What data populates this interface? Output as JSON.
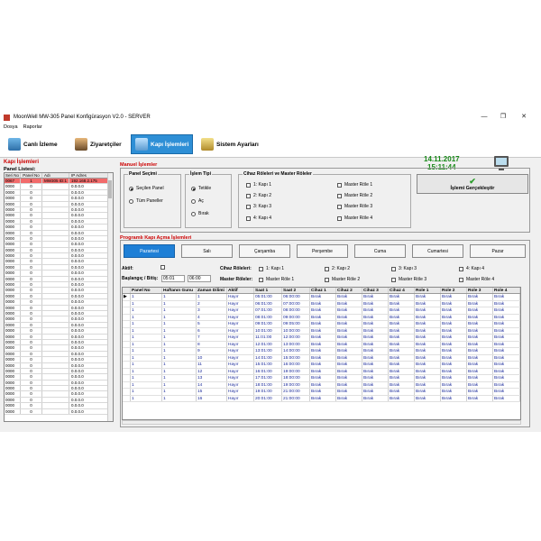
{
  "window": {
    "title": "MoonWell MW-305 Panel Konfigürasyon V2.0 - SERVER",
    "minimize": "—",
    "maximize": "❐",
    "close": "✕"
  },
  "menu": [
    "Dosya",
    "Raporlar"
  ],
  "toolbar": {
    "live": "Canlı İzleme",
    "visitors": "Ziyaretçiler",
    "doors": "Kapı İşlemleri",
    "settings": "Sistem Ayarları"
  },
  "clock": {
    "date": "14.11.2017",
    "time": "15:11:44"
  },
  "section_title": "Kapı İşlemleri",
  "panel_list": {
    "label": "Panel Listesi:",
    "headers": [
      "Seri No",
      "Panel No",
      "Adı",
      "IP Adres"
    ],
    "rows": [
      [
        "0067",
        "1",
        "MW305 ID:1",
        "192.168.2.175"
      ],
      [
        "0000",
        "0",
        "",
        "0.0.0.0"
      ],
      [
        "0000",
        "0",
        "",
        "0.0.0.0"
      ],
      [
        "0000",
        "0",
        "",
        "0.0.0.0"
      ],
      [
        "0000",
        "0",
        "",
        "0.0.0.0"
      ],
      [
        "0000",
        "0",
        "",
        "0.0.0.0"
      ],
      [
        "0000",
        "0",
        "",
        "0.0.0.0"
      ],
      [
        "0000",
        "0",
        "",
        "0.0.0.0"
      ],
      [
        "0000",
        "0",
        "",
        "0.0.0.0"
      ],
      [
        "0000",
        "0",
        "",
        "0.0.0.0"
      ],
      [
        "0000",
        "0",
        "",
        "0.0.0.0"
      ],
      [
        "0000",
        "0",
        "",
        "0.0.0.0"
      ],
      [
        "0000",
        "0",
        "",
        "0.0.0.0"
      ],
      [
        "0000",
        "0",
        "",
        "0.0.0.0"
      ],
      [
        "0000",
        "0",
        "",
        "0.0.0.0"
      ],
      [
        "0000",
        "0",
        "",
        "0.0.0.0"
      ],
      [
        "0000",
        "0",
        "",
        "0.0.0.0"
      ],
      [
        "0000",
        "0",
        "",
        "0.0.0.0"
      ],
      [
        "0000",
        "0",
        "",
        "0.0.0.0"
      ],
      [
        "0000",
        "0",
        "",
        "0.0.0.0"
      ],
      [
        "0000",
        "0",
        "",
        "0.0.0.0"
      ],
      [
        "0000",
        "0",
        "",
        "0.0.0.0"
      ],
      [
        "0000",
        "0",
        "",
        "0.0.0.0"
      ],
      [
        "0000",
        "0",
        "",
        "0.0.0.0"
      ],
      [
        "0000",
        "0",
        "",
        "0.0.0.0"
      ],
      [
        "0000",
        "0",
        "",
        "0.0.0.0"
      ],
      [
        "0000",
        "0",
        "",
        "0.0.0.0"
      ],
      [
        "0000",
        "0",
        "",
        "0.0.0.0"
      ],
      [
        "0000",
        "0",
        "",
        "0.0.0.0"
      ],
      [
        "0000",
        "0",
        "",
        "0.0.0.0"
      ],
      [
        "0000",
        "0",
        "",
        "0.0.0.0"
      ],
      [
        "0000",
        "0",
        "",
        "0.0.0.0"
      ],
      [
        "0000",
        "0",
        "",
        "0.0.0.0"
      ],
      [
        "0000",
        "0",
        "",
        "0.0.0.0"
      ],
      [
        "0000",
        "0",
        "",
        "0.0.0.0"
      ],
      [
        "0000",
        "0",
        "",
        "0.0.0.0"
      ],
      [
        "0000",
        "0",
        "",
        "0.0.0.0"
      ],
      [
        "0000",
        "0",
        "",
        "0.0.0.0"
      ],
      [
        "0000",
        "0",
        "",
        "0.0.0.0"
      ],
      [
        "0000",
        "0",
        "",
        "0.0.0.0"
      ],
      [
        "0000",
        "0",
        "",
        "0.0.0.0"
      ]
    ]
  },
  "manual": {
    "title": "Manuel İşlemler",
    "panel_select": {
      "title": "Panel Seçimi",
      "selected": "Seçilen Panel",
      "all": "Tüm Paneller"
    },
    "action_type": {
      "title": "İşlem Tipi",
      "lock": "Tetikle",
      "open": "Aç",
      "leave": "Bırak"
    },
    "relays": {
      "title": "Cihaz Röleleri  ve  Master Röleler",
      "doors": [
        "1: Kapı 1",
        "2: Kapı 2",
        "3: Kapı 3",
        "4: Kapı 4"
      ],
      "masters": [
        "Master Röle 1",
        "Master Röle 2",
        "Master Röle 3",
        "Master Röle 4"
      ]
    },
    "run_button": "İşlemi Gerçekleştir"
  },
  "program": {
    "title": "Programlı Kapı Açma İşlemleri",
    "days": [
      "Pazartesi",
      "Salı",
      "Çarşamba",
      "Perşembe",
      "Cuma",
      "Cumartesi",
      "Pazar"
    ],
    "active_label": "Aktif:",
    "start_end_label": "Başlangıç / Bitiş:",
    "start": "05:01",
    "end": "06:00",
    "device_relays_label": "Cihaz Röleleri:",
    "master_relays_label": "Master Röleler:",
    "doors": [
      "1: Kapı 1",
      "2: Kapı 2",
      "3: Kapı 3",
      "4: Kapı 4"
    ],
    "masters": [
      "Master Röle 1",
      "Master Röle 2",
      "Master Röle 3",
      "Master Röle 4"
    ]
  },
  "schedule": {
    "headers": [
      "",
      "Panel No",
      "Haftanın Gunu",
      "Zaman Dilimi",
      "Aktif",
      "Saat 1",
      "Saat 2",
      "Cihaz 1",
      "Cihaz 2",
      "Cihaz 3",
      "Cihaz 4",
      "Role 1",
      "Role 2",
      "Role 3",
      "Role 4"
    ],
    "rows": [
      [
        "▶",
        "1",
        "1",
        "1",
        "Hayır",
        "05:01:00",
        "06:00:00",
        "Bırak",
        "Bırak",
        "Bırak",
        "Bırak",
        "Bırak",
        "Bırak",
        "Bırak",
        "Bırak"
      ],
      [
        "",
        "1",
        "1",
        "2",
        "Hayır",
        "06:01:00",
        "07:00:00",
        "Bırak",
        "Bırak",
        "Bırak",
        "Bırak",
        "Bırak",
        "Bırak",
        "Bırak",
        "Bırak"
      ],
      [
        "",
        "1",
        "1",
        "3",
        "Hayır",
        "07:01:00",
        "08:00:00",
        "Bırak",
        "Bırak",
        "Bırak",
        "Bırak",
        "Bırak",
        "Bırak",
        "Bırak",
        "Bırak"
      ],
      [
        "",
        "1",
        "1",
        "4",
        "Hayır",
        "08:01:00",
        "09:00:00",
        "Bırak",
        "Bırak",
        "Bırak",
        "Bırak",
        "Bırak",
        "Bırak",
        "Bırak",
        "Bırak"
      ],
      [
        "",
        "1",
        "1",
        "5",
        "Hayır",
        "09:01:00",
        "09:05:00",
        "Bırak",
        "Bırak",
        "Bırak",
        "Bırak",
        "Bırak",
        "Bırak",
        "Bırak",
        "Bırak"
      ],
      [
        "",
        "1",
        "1",
        "6",
        "Hayır",
        "10:01:00",
        "10:00:00",
        "Bırak",
        "Bırak",
        "Bırak",
        "Bırak",
        "Bırak",
        "Bırak",
        "Bırak",
        "Bırak"
      ],
      [
        "",
        "1",
        "1",
        "7",
        "Hayır",
        "11:01:00",
        "12:00:00",
        "Bırak",
        "Bırak",
        "Bırak",
        "Bırak",
        "Bırak",
        "Bırak",
        "Bırak",
        "Bırak"
      ],
      [
        "",
        "1",
        "1",
        "8",
        "Hayır",
        "12:01:00",
        "13:00:00",
        "Bırak",
        "Bırak",
        "Bırak",
        "Bırak",
        "Bırak",
        "Bırak",
        "Bırak",
        "Bırak"
      ],
      [
        "",
        "1",
        "1",
        "9",
        "Hayır",
        "13:01:00",
        "14:00:00",
        "Bırak",
        "Bırak",
        "Bırak",
        "Bırak",
        "Bırak",
        "Bırak",
        "Bırak",
        "Bırak"
      ],
      [
        "",
        "1",
        "1",
        "10",
        "Hayır",
        "14:01:00",
        "15:00:00",
        "Bırak",
        "Bırak",
        "Bırak",
        "Bırak",
        "Bırak",
        "Bırak",
        "Bırak",
        "Bırak"
      ],
      [
        "",
        "1",
        "1",
        "11",
        "Hayır",
        "15:01:00",
        "16:00:00",
        "Bırak",
        "Bırak",
        "Bırak",
        "Bırak",
        "Bırak",
        "Bırak",
        "Bırak",
        "Bırak"
      ],
      [
        "",
        "1",
        "1",
        "12",
        "Hayır",
        "16:01:00",
        "19:00:00",
        "Bırak",
        "Bırak",
        "Bırak",
        "Bırak",
        "Bırak",
        "Bırak",
        "Bırak",
        "Bırak"
      ],
      [
        "",
        "1",
        "1",
        "13",
        "Hayır",
        "17:01:00",
        "18:00:00",
        "Bırak",
        "Bırak",
        "Bırak",
        "Bırak",
        "Bırak",
        "Bırak",
        "Bırak",
        "Bırak"
      ],
      [
        "",
        "1",
        "1",
        "14",
        "Hayır",
        "18:01:00",
        "19:00:00",
        "Bırak",
        "Bırak",
        "Bırak",
        "Bırak",
        "Bırak",
        "Bırak",
        "Bırak",
        "Bırak"
      ],
      [
        "",
        "1",
        "1",
        "15",
        "Hayır",
        "19:01:00",
        "21:00:00",
        "Bırak",
        "Bırak",
        "Bırak",
        "Bırak",
        "Bırak",
        "Bırak",
        "Bırak",
        "Bırak"
      ],
      [
        "",
        "1",
        "1",
        "16",
        "Hayır",
        "20:01:00",
        "21:00:00",
        "Bırak",
        "Bırak",
        "Bırak",
        "Bırak",
        "Bırak",
        "Bırak",
        "Bırak",
        "Bırak"
      ]
    ]
  },
  "colors": {
    "accent": "#2e8fd6",
    "section_title": "#cc0000",
    "clock": "#1a8a1a",
    "selected_row": "#f26b6b"
  }
}
